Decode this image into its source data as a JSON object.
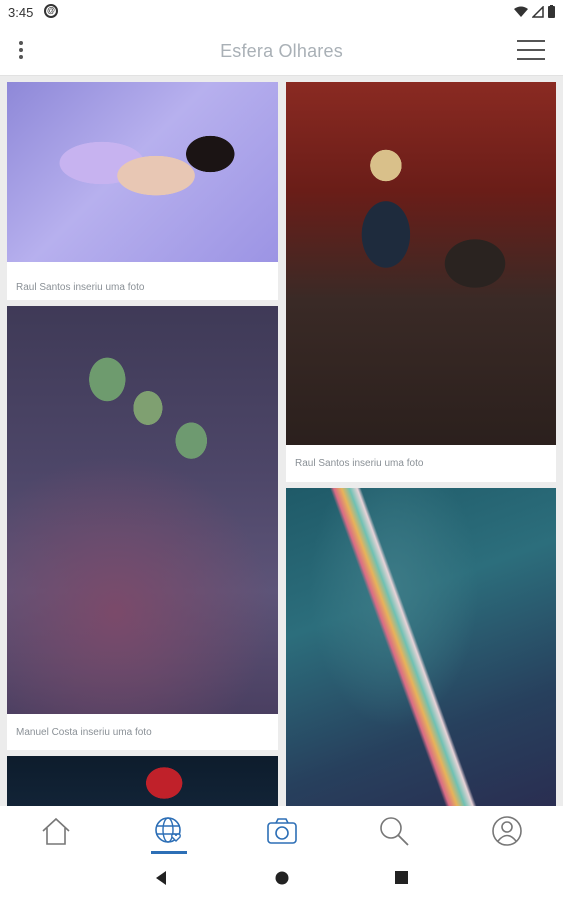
{
  "status_bar": {
    "time": "3:45"
  },
  "app_bar": {
    "title": "Esfera Olhares"
  },
  "feed": {
    "posts": [
      {
        "caption": "Raul Santos inseriu uma foto"
      },
      {
        "caption": "Manuel Costa inseriu uma foto"
      },
      {
        "caption": "Raul Santos inseriu uma foto"
      }
    ]
  },
  "bottom_nav": {
    "items": [
      {
        "icon": "home-icon"
      },
      {
        "icon": "globe-heart-icon",
        "active": true
      },
      {
        "icon": "camera-icon"
      },
      {
        "icon": "search-icon"
      },
      {
        "icon": "profile-icon"
      }
    ]
  },
  "colors": {
    "accent": "#2d6fb6",
    "title": "#a9b0b6",
    "caption": "#8a9096",
    "background": "#ececec"
  }
}
